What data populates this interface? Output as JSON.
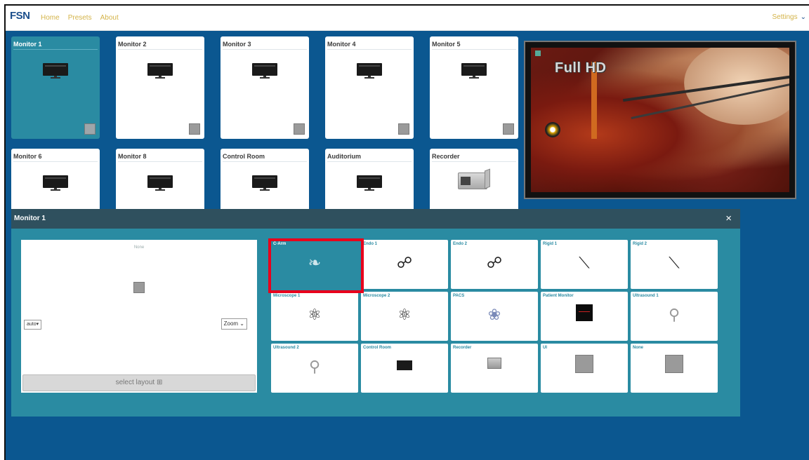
{
  "nav": {
    "logo": "FSN",
    "logo_sub": "",
    "links": [
      "Home",
      "Presets",
      "About"
    ],
    "settings": "Settings"
  },
  "monitors": [
    {
      "name": "Monitor 1",
      "active": true
    },
    {
      "name": "Monitor 2",
      "active": false
    },
    {
      "name": "Monitor 3",
      "active": false
    },
    {
      "name": "Monitor 4",
      "active": false
    },
    {
      "name": "Monitor 5",
      "active": false
    },
    {
      "name": "Monitor 6",
      "active": false
    },
    {
      "name": "Monitor 8",
      "active": false
    },
    {
      "name": "Control Room",
      "active": false
    },
    {
      "name": "Auditorium",
      "active": false
    },
    {
      "name": "Recorder",
      "active": false
    }
  ],
  "preview": {
    "overlay": "Full HD"
  },
  "panel": {
    "title": "Monitor 1",
    "close": "×",
    "layout_label": "None",
    "auto_select": "auto",
    "zoom_select": "Zoom",
    "select_layout": "select layout"
  },
  "sources": [
    {
      "name": "C-Arm",
      "icon": "c-arm-icon",
      "active": true
    },
    {
      "name": "Endo 1",
      "icon": "endoscope-icon"
    },
    {
      "name": "Endo 2",
      "icon": "endoscope-icon"
    },
    {
      "name": "Rigid 1",
      "icon": "rigid-scope-icon"
    },
    {
      "name": "Rigid 2",
      "icon": "rigid-scope-icon"
    },
    {
      "name": "Microscope 1",
      "icon": "microscope-icon"
    },
    {
      "name": "Microscope 2",
      "icon": "microscope-icon"
    },
    {
      "name": "PACS",
      "icon": "xray-icon"
    },
    {
      "name": "Patient Monitor",
      "icon": "patient-monitor-icon"
    },
    {
      "name": "Ultrasound 1",
      "icon": "ultrasound-icon"
    },
    {
      "name": "Ultrasound 2",
      "icon": "ultrasound-icon"
    },
    {
      "name": "Control Room",
      "icon": "monitor-icon"
    },
    {
      "name": "Recorder",
      "icon": "recorder-icon"
    },
    {
      "name": "UI",
      "icon": "placeholder-icon"
    },
    {
      "name": "None",
      "icon": "placeholder-icon"
    }
  ],
  "colors": {
    "background": "#0b5790",
    "accent": "#2a8ba2",
    "panel_header": "#2f505e",
    "highlight": "#e8001c"
  }
}
